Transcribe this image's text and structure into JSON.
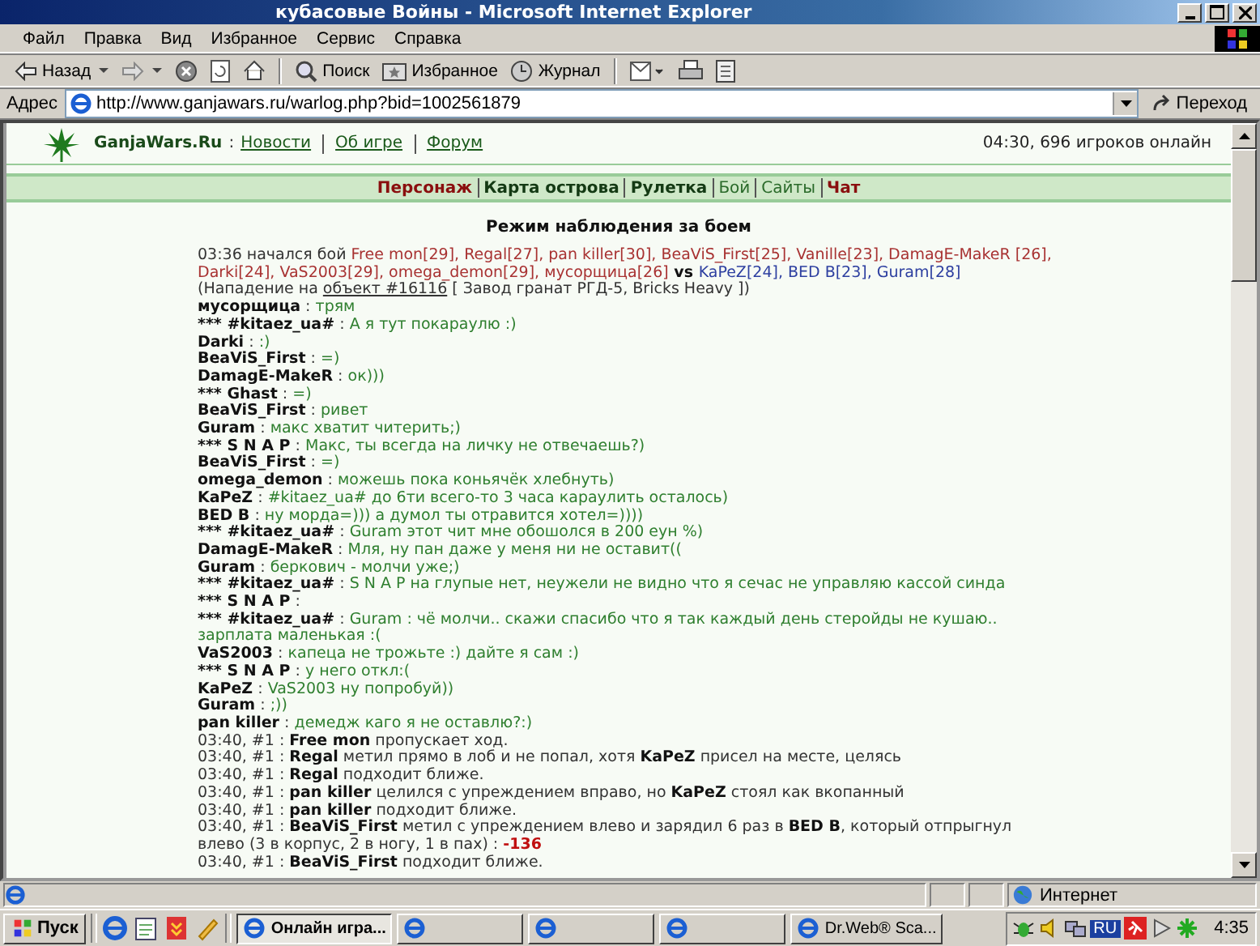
{
  "window": {
    "title": "кубасовые Войны - Microsoft Internet Explorer"
  },
  "menu": [
    "Файл",
    "Правка",
    "Вид",
    "Избранное",
    "Сервис",
    "Справка"
  ],
  "toolbar": [
    {
      "kind": "back",
      "label": "Назад"
    },
    {
      "kind": "forward"
    },
    {
      "kind": "stop"
    },
    {
      "kind": "refresh"
    },
    {
      "kind": "home"
    },
    {
      "kind": "sep"
    },
    {
      "kind": "search",
      "label": "Поиск"
    },
    {
      "kind": "favorites",
      "label": "Избранное"
    },
    {
      "kind": "history",
      "label": "Журнал"
    },
    {
      "kind": "sep"
    },
    {
      "kind": "mail"
    },
    {
      "kind": "print"
    },
    {
      "kind": "edit"
    }
  ],
  "address": {
    "label": "Адрес",
    "url": "http://www.ganjawars.ru/warlog.php?bid=1002561879",
    "go": "Переход"
  },
  "site": {
    "logo": "GanjaWars.Ru",
    "sep": ":",
    "links": [
      "Новости",
      "Об игре",
      "Форум"
    ],
    "online": "04:30, 696 игроков онлайн"
  },
  "nav": [
    {
      "label": "Персонаж",
      "kind": "accent"
    },
    {
      "label": "Карта острова",
      "kind": "bold"
    },
    {
      "label": "Рулетка",
      "kind": "bold"
    },
    {
      "label": "Бой",
      "kind": "plain"
    },
    {
      "label": "Сайты",
      "kind": "plain"
    },
    {
      "label": "Чат",
      "kind": "accent"
    }
  ],
  "heading": "Режим наблюдения за боем",
  "log": [
    [
      {
        "t": "03:36 начался бой ",
        "kind": "text"
      },
      {
        "t": "Free mon[29], Regal[27], pan killer[30], BeaViS_First[25], Vanille[23], DamagE-MakeR [26], Darki[24], VaS2003[29], omega_demon[29], мусорщица[26]",
        "kind": "red"
      },
      {
        "t": " vs ",
        "kind": "name"
      },
      {
        "t": "KaPeZ[24], BED B[23], Guram[28]",
        "kind": "blue"
      }
    ],
    [
      {
        "t": "(Нападение на ",
        "kind": "text"
      },
      {
        "t": "объект #16116",
        "kind": "link"
      },
      {
        "t": " [ Завод гранат РГД-5, Bricks Heavy ])",
        "kind": "text"
      }
    ],
    [
      {
        "t": "мусорщица",
        "kind": "name"
      },
      {
        "t": " : ",
        "kind": "text"
      },
      {
        "t": "трям",
        "kind": "msg"
      }
    ],
    [
      {
        "t": "*** #kitaez_ua#",
        "kind": "name"
      },
      {
        "t": " : ",
        "kind": "text"
      },
      {
        "t": "А я тут покараулю :)",
        "kind": "msg"
      }
    ],
    [
      {
        "t": "Darki",
        "kind": "name"
      },
      {
        "t": " : ",
        "kind": "text"
      },
      {
        "t": ":)",
        "kind": "msg"
      }
    ],
    [
      {
        "t": "BeaViS_First",
        "kind": "name"
      },
      {
        "t": " : ",
        "kind": "text"
      },
      {
        "t": "=)",
        "kind": "msg"
      }
    ],
    [
      {
        "t": "DamagE-MakeR",
        "kind": "name"
      },
      {
        "t": " : ",
        "kind": "text"
      },
      {
        "t": "ок)))",
        "kind": "msg"
      }
    ],
    [
      {
        "t": "*** Ghast",
        "kind": "name"
      },
      {
        "t": " : ",
        "kind": "text"
      },
      {
        "t": "=)",
        "kind": "msg"
      }
    ],
    [
      {
        "t": "BeaViS_First",
        "kind": "name"
      },
      {
        "t": " : ",
        "kind": "text"
      },
      {
        "t": "ривет",
        "kind": "msg"
      }
    ],
    [
      {
        "t": "Guram",
        "kind": "name"
      },
      {
        "t": " : ",
        "kind": "text"
      },
      {
        "t": "макс хватит читерить;)",
        "kind": "msg"
      }
    ],
    [
      {
        "t": "*** S N A P",
        "kind": "name"
      },
      {
        "t": " : ",
        "kind": "text"
      },
      {
        "t": "Макс, ты всегда на личку не отвечаешь?)",
        "kind": "msg"
      }
    ],
    [
      {
        "t": "BeaViS_First",
        "kind": "name"
      },
      {
        "t": " : ",
        "kind": "text"
      },
      {
        "t": "=)",
        "kind": "msg"
      }
    ],
    [
      {
        "t": "omega_demon",
        "kind": "name"
      },
      {
        "t": " : ",
        "kind": "text"
      },
      {
        "t": "можешь пока коньячёк хлебнуть)",
        "kind": "msg"
      }
    ],
    [
      {
        "t": "KaPeZ",
        "kind": "name"
      },
      {
        "t": " : ",
        "kind": "text"
      },
      {
        "t": "#kitaez_ua# до 6ти всего-то 3 часа караулить осталось)",
        "kind": "msg"
      }
    ],
    [
      {
        "t": "BED B",
        "kind": "name"
      },
      {
        "t": " : ",
        "kind": "text"
      },
      {
        "t": "ну морда=))) а думол ты отравится хотел=))))",
        "kind": "msg"
      }
    ],
    [
      {
        "t": "*** #kitaez_ua#",
        "kind": "name"
      },
      {
        "t": " : ",
        "kind": "text"
      },
      {
        "t": "Guram этот чит мне обошолся в 200 еун %)",
        "kind": "msg"
      }
    ],
    [
      {
        "t": "DamagE-MakeR",
        "kind": "name"
      },
      {
        "t": " : ",
        "kind": "text"
      },
      {
        "t": "Мля, ну пан даже у меня ни не оставит((",
        "kind": "msg"
      }
    ],
    [
      {
        "t": "Guram",
        "kind": "name"
      },
      {
        "t": " : ",
        "kind": "text"
      },
      {
        "t": "беркович - молчи уже;)",
        "kind": "msg"
      }
    ],
    [
      {
        "t": "*** #kitaez_ua#",
        "kind": "name"
      },
      {
        "t": " : ",
        "kind": "text"
      },
      {
        "t": "S N A P на глупые нет, неужели не видно что я сечас не управляю кассой синда",
        "kind": "msg"
      }
    ],
    [
      {
        "t": "*** S N A P",
        "kind": "name"
      },
      {
        "t": " :",
        "kind": "text"
      }
    ],
    [
      {
        "t": "*** #kitaez_ua#",
        "kind": "name"
      },
      {
        "t": " : ",
        "kind": "text"
      },
      {
        "t": "Guram : чё молчи.. скажи спасибо что я так каждый день стеройды не кушаю.. зарплата маленькая :(",
        "kind": "msg"
      }
    ],
    [
      {
        "t": "VaS2003",
        "kind": "name"
      },
      {
        "t": " : ",
        "kind": "text"
      },
      {
        "t": "капеца не трожьте :) дайте я сам :)",
        "kind": "msg"
      }
    ],
    [
      {
        "t": "*** S N A P",
        "kind": "name"
      },
      {
        "t": " : ",
        "kind": "text"
      },
      {
        "t": "у него откл:(",
        "kind": "msg"
      }
    ],
    [
      {
        "t": "KaPeZ",
        "kind": "name"
      },
      {
        "t": " : ",
        "kind": "text"
      },
      {
        "t": "VaS2003 ну попробуй))",
        "kind": "msg"
      }
    ],
    [
      {
        "t": "Guram",
        "kind": "name"
      },
      {
        "t": " : ",
        "kind": "text"
      },
      {
        "t": ";))",
        "kind": "msg"
      }
    ],
    [
      {
        "t": "pan killer",
        "kind": "name"
      },
      {
        "t": " : ",
        "kind": "text"
      },
      {
        "t": "демедж каго я не оставлю?:)",
        "kind": "msg"
      }
    ],
    [
      {
        "t": "03:40, #1 : ",
        "kind": "text"
      },
      {
        "t": "Free mon",
        "kind": "name"
      },
      {
        "t": " пропускает ход.",
        "kind": "text"
      }
    ],
    [
      {
        "t": "03:40, #1 : ",
        "kind": "text"
      },
      {
        "t": "Regal",
        "kind": "name"
      },
      {
        "t": " метил прямо в лоб и не попал, хотя ",
        "kind": "text"
      },
      {
        "t": "KaPeZ",
        "kind": "name"
      },
      {
        "t": " присел на месте, целясь",
        "kind": "text"
      }
    ],
    [
      {
        "t": "03:40, #1 : ",
        "kind": "text"
      },
      {
        "t": "Regal",
        "kind": "name"
      },
      {
        "t": " подходит ближе.",
        "kind": "text"
      }
    ],
    [
      {
        "t": "03:40, #1 : ",
        "kind": "text"
      },
      {
        "t": "pan killer",
        "kind": "name"
      },
      {
        "t": " целился с упреждением вправо, но ",
        "kind": "text"
      },
      {
        "t": "KaPeZ",
        "kind": "name"
      },
      {
        "t": " стоял как вкопанный",
        "kind": "text"
      }
    ],
    [
      {
        "t": "03:40, #1 : ",
        "kind": "text"
      },
      {
        "t": "pan killer",
        "kind": "name"
      },
      {
        "t": " подходит ближе.",
        "kind": "text"
      }
    ],
    [
      {
        "t": "03:40, #1 : ",
        "kind": "text"
      },
      {
        "t": "BeaViS_First",
        "kind": "name"
      },
      {
        "t": " метил с упреждением влево и зарядил 6 раз в ",
        "kind": "text"
      },
      {
        "t": "BED B",
        "kind": "name"
      },
      {
        "t": ", который отпрыгнул влево (3 в корпус, 2 в ногу, 1 в пах) : ",
        "kind": "text"
      },
      {
        "t": "-136",
        "kind": "dmg"
      }
    ],
    [
      {
        "t": "03:40, #1 : ",
        "kind": "text"
      },
      {
        "t": "BeaViS_First",
        "kind": "name"
      },
      {
        "t": " подходит ближе.",
        "kind": "text"
      }
    ]
  ],
  "status": {
    "zone": "Интернет"
  },
  "taskbar": {
    "start": "Пуск",
    "tasks": [
      {
        "label": "Онлайн игра...",
        "selected": true
      },
      {
        "selected": false
      },
      {
        "selected": false
      },
      {
        "selected": false
      },
      {
        "label": "Dr.Web® Sca...",
        "selected": false
      }
    ],
    "lang": "RU",
    "clock": "4:35"
  }
}
